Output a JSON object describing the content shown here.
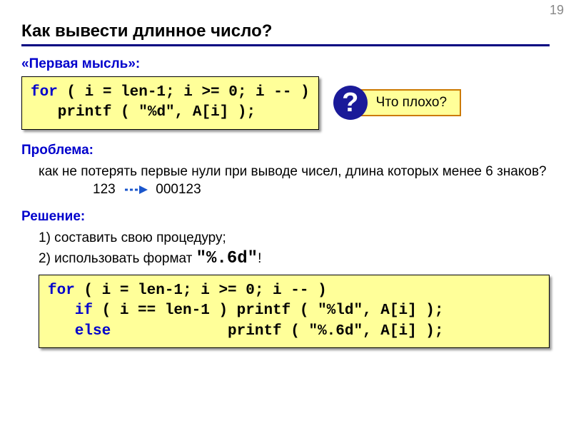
{
  "page_number": "19",
  "title": "Как вывести длинное число?",
  "heading_first_thought": "«Первая мысль»:",
  "code1": {
    "l1a": "for",
    "l1b": " ( i = len-1; i >= 0; i -- )",
    "l2a": "   printf ( ",
    "l2b": "\"%d\"",
    "l2c": ", A[i] );"
  },
  "callout": {
    "q": "?",
    "text": "Что плохо?"
  },
  "heading_problem": "Проблема:",
  "problem_text": "как не потерять первые нули при выводе чисел, длина которых менее 6 знаков?",
  "example_before": "123",
  "example_after": "000123",
  "heading_solution": "Решение:",
  "solution_item1": "1) составить свою процедуру;",
  "solution_item2_a": "2) использовать формат ",
  "solution_item2_b": "\"%.6d\"",
  "solution_item2_c": "!",
  "code2": {
    "l1a": "for",
    "l1b": " ( i = len-1; i >= 0; i -- )",
    "l2a": "   if",
    "l2b": " ( i == len-1 ) printf ( ",
    "l2c": "\"%ld\"",
    "l2d": ", A[i] );",
    "l3a": "   else",
    "l3b": "             printf ( ",
    "l3c": "\"%.6d\"",
    "l3d": ", A[i] );"
  }
}
